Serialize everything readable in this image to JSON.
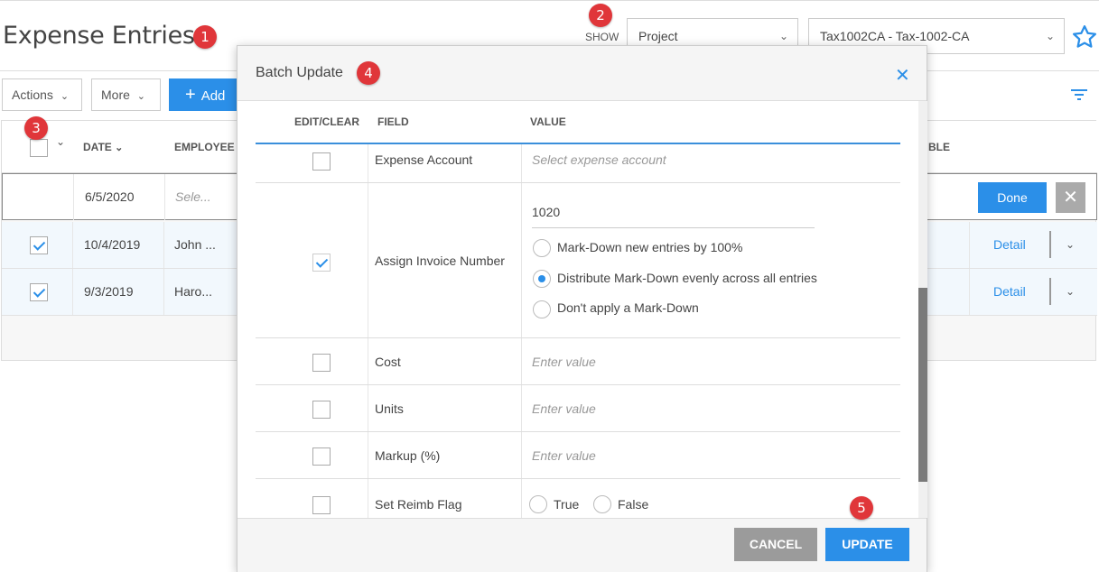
{
  "page": {
    "title": "Expense Entries"
  },
  "badges": [
    "1",
    "2",
    "3",
    "4",
    "5"
  ],
  "show": {
    "label": "SHOW",
    "type_value": "Project",
    "project_value": "Tax1002CA - Tax-1002-CA"
  },
  "toolbar": {
    "actions_label": "Actions",
    "more_label": "More",
    "add_label": "Add"
  },
  "grid": {
    "headers": {
      "date": "DATE",
      "employee": "EMPLOYEE",
      "billable": "BLE"
    },
    "rows": [
      {
        "date": "6/5/2020",
        "employee": "Sele...",
        "checked": false,
        "editing": true
      },
      {
        "date": "10/4/2019",
        "employee": "John ...",
        "checked": true
      },
      {
        "date": "9/3/2019",
        "employee": "Haro...",
        "checked": true
      }
    ],
    "done_label": "Done",
    "detail_label": "Detail"
  },
  "modal": {
    "title": "Batch Update",
    "headers": {
      "edit_clear": "EDIT/CLEAR",
      "field": "FIELD",
      "value": "VALUE"
    },
    "rows": {
      "expense_account": {
        "field": "Expense Account",
        "placeholder": "Select expense account",
        "checked": false
      },
      "assign_invoice": {
        "field": "Assign Invoice Number",
        "value": "1020",
        "checked": true,
        "options": [
          {
            "label": "Mark-Down new entries by 100%",
            "selected": false
          },
          {
            "label": "Distribute Mark-Down evenly across all entries",
            "selected": true
          },
          {
            "label": "Don't apply a Mark-Down",
            "selected": false
          }
        ]
      },
      "cost": {
        "field": "Cost",
        "placeholder": "Enter value",
        "checked": false
      },
      "units": {
        "field": "Units",
        "placeholder": "Enter value",
        "checked": false
      },
      "markup": {
        "field": "Markup (%)",
        "placeholder": "Enter value",
        "checked": false
      },
      "reimb": {
        "field": "Set Reimb Flag",
        "true_label": "True",
        "false_label": "False",
        "checked": false
      }
    },
    "cancel_label": "CANCEL",
    "update_label": "UPDATE"
  },
  "colors": {
    "accent": "#2b8fe8",
    "badge": "#e0363a",
    "cancel": "#9b9b9b"
  }
}
